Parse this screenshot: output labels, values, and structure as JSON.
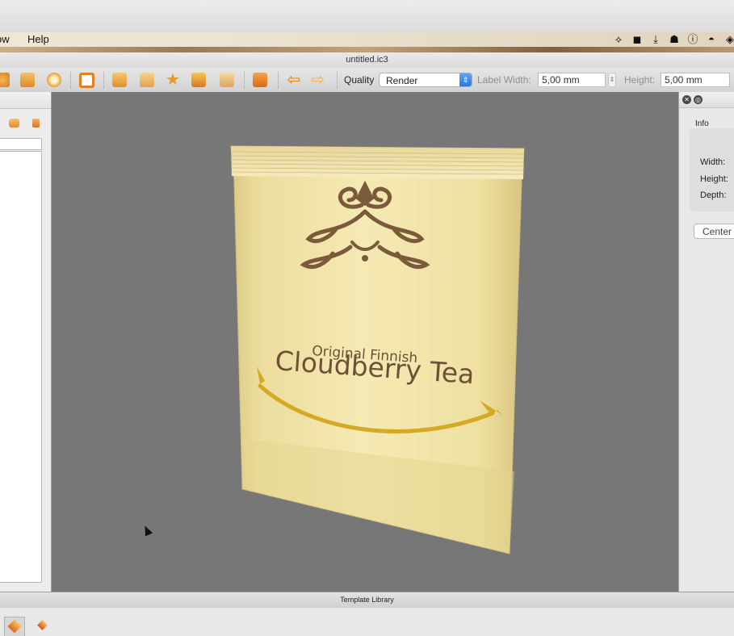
{
  "menubar": {
    "items": [
      "ow",
      "Help"
    ],
    "status_icons": [
      "dropbox-icon",
      "app-square-icon",
      "download-icon",
      "hat-icon",
      "info-circle-icon",
      "cup-icon",
      "layers-icon"
    ]
  },
  "window": {
    "title": "untitled.ic3"
  },
  "toolbar": {
    "quality_label": "Quality",
    "quality_value": "Render",
    "label_width_label": "Label Width:",
    "label_width_value": "5,00 mm",
    "height_label": "Height:",
    "height_value": "5,00 mm",
    "icons": [
      "nav-icon",
      "frame-icon",
      "disc-icon",
      "crop-icon",
      "arrow-right-icon",
      "edit-icon",
      "star-icon",
      "pdf-export-icon",
      "pdf-import-icon",
      "camera-icon",
      "undo-icon",
      "redo-icon"
    ]
  },
  "viewport": {
    "product": {
      "subtitle": "Original Finnish",
      "title": "Cloudberry Tea"
    }
  },
  "info_panel": {
    "title": "Info",
    "rows": [
      "Width:",
      "Height:",
      "Depth:"
    ],
    "center_button": "Center"
  },
  "library": {
    "title": "Template Library"
  },
  "colors": {
    "viewport_bg": "#777777",
    "package_gold": "#efe2a2",
    "ornament_brown": "#7a5a3b",
    "swoosh_gold": "#d6a925"
  }
}
